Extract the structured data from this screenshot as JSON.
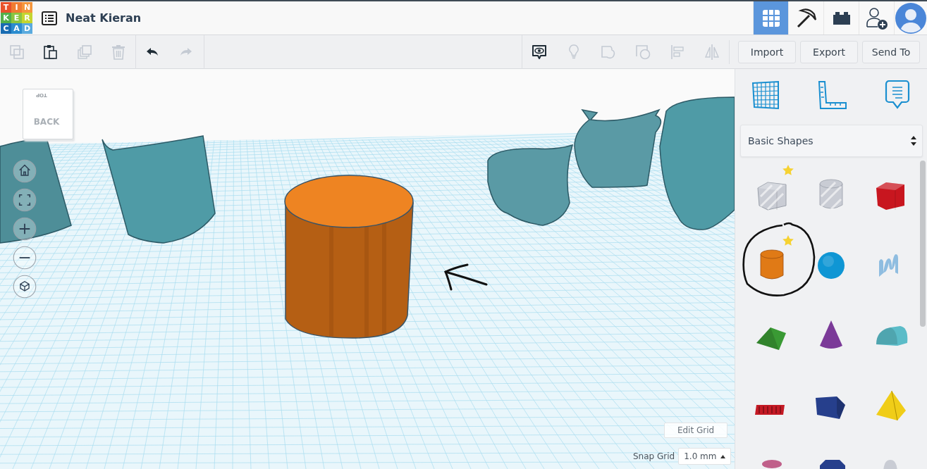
{
  "logo": {
    "tiles": [
      {
        "letter": "T",
        "color": "#e8512b"
      },
      {
        "letter": "I",
        "color": "#f07c32"
      },
      {
        "letter": "N",
        "color": "#f4963c"
      },
      {
        "letter": "K",
        "color": "#52b04a"
      },
      {
        "letter": "E",
        "color": "#8cc540"
      },
      {
        "letter": "R",
        "color": "#c5d52f"
      },
      {
        "letter": "C",
        "color": "#186bb2"
      },
      {
        "letter": "A",
        "color": "#2b8ccf"
      },
      {
        "letter": "D",
        "color": "#5aaade"
      }
    ]
  },
  "project": {
    "title": "Neat Kieran"
  },
  "nav": [
    {
      "kind": "grid",
      "selected": true
    },
    {
      "kind": "pickaxe",
      "selected": false
    },
    {
      "kind": "bricks",
      "selected": false
    },
    {
      "kind": "add-user",
      "selected": false
    },
    {
      "kind": "avatar",
      "selected": false
    }
  ],
  "toolbar": {
    "edit_tools": [
      {
        "kind": "copy",
        "disabled": true
      },
      {
        "kind": "paste",
        "disabled": false
      },
      {
        "kind": "duplicate",
        "disabled": true
      },
      {
        "kind": "delete",
        "disabled": true
      }
    ],
    "history_tools": [
      {
        "kind": "undo",
        "disabled": false
      },
      {
        "kind": "redo",
        "disabled": true
      }
    ],
    "view_tools": [
      {
        "kind": "notes",
        "disabled": false
      },
      {
        "kind": "bulb",
        "disabled": true
      },
      {
        "kind": "solid",
        "disabled": true
      },
      {
        "kind": "hole",
        "disabled": true
      },
      {
        "kind": "align",
        "disabled": true
      },
      {
        "kind": "mirror",
        "disabled": true
      }
    ],
    "buttons": [
      "Import",
      "Export",
      "Send To"
    ]
  },
  "view_cube": {
    "front": "BACK",
    "top": "TOP"
  },
  "view_controls": [
    {
      "kind": "home"
    },
    {
      "kind": "fit"
    },
    {
      "kind": "zoom-in"
    },
    {
      "kind": "zoom-out"
    },
    {
      "kind": "perspective"
    }
  ],
  "grid_controls": {
    "edit_button": "Edit Grid",
    "snap_label": "Snap Grid",
    "snap_value": "1.0 mm"
  },
  "panel": {
    "tools": [
      {
        "kind": "workplane"
      },
      {
        "kind": "ruler"
      },
      {
        "kind": "notes"
      }
    ],
    "library": "Basic Shapes",
    "shapes": [
      {
        "kind": "box-hole",
        "color": "#c9ccd4",
        "starred": true
      },
      {
        "kind": "cylinder-hole",
        "color": "#c9ccd4",
        "starred": false
      },
      {
        "kind": "box",
        "color": "#c8161f",
        "starred": false
      },
      {
        "kind": "cylinder",
        "color": "#e07a16",
        "starred": true
      },
      {
        "kind": "sphere",
        "color": "#0f96d4",
        "starred": false
      },
      {
        "kind": "scribble",
        "color": "#8fbde0",
        "starred": false
      },
      {
        "kind": "roof",
        "color": "#3a9a34",
        "starred": false
      },
      {
        "kind": "cone",
        "color": "#7b3a98",
        "starred": false
      },
      {
        "kind": "round-roof",
        "color": "#5bbcc8",
        "starred": false
      },
      {
        "kind": "text",
        "color": "#c41a24",
        "starred": false
      },
      {
        "kind": "polygon",
        "color": "#263f8c",
        "starred": false
      },
      {
        "kind": "pyramid",
        "color": "#f0cd18",
        "starred": false
      },
      {
        "kind": "torus",
        "color": "#c0608a",
        "starred": false
      },
      {
        "kind": "hexagon",
        "color": "#263f8c",
        "starred": false
      },
      {
        "kind": "paraboloid",
        "color": "#c9ccd4",
        "starred": false
      }
    ]
  }
}
